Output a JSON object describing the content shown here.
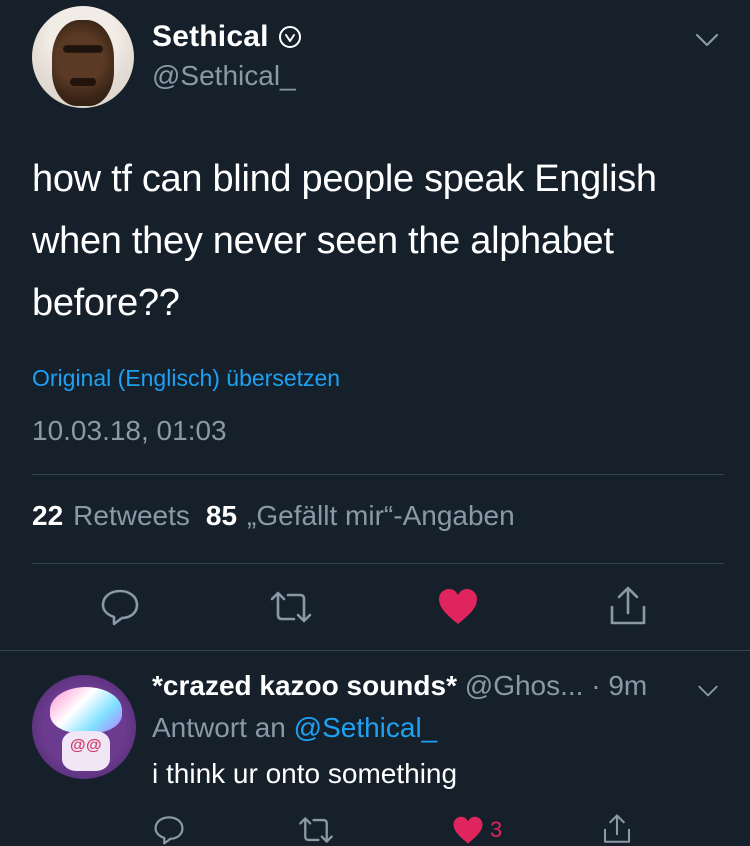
{
  "tweet": {
    "author_name": "Sethical",
    "author_handle": "@Sethical_",
    "text_line1": "how tf can blind people speak English",
    "text_line2": "when they never seen the alphabet",
    "text_line3": "before??",
    "translate_link": "Original (Englisch) übersetzen",
    "timestamp": "10.03.18, 01:03",
    "retweet_count": "22",
    "retweet_label": "Retweets",
    "like_count": "85",
    "like_label": "„Gefällt mir“-Angaben"
  },
  "reply": {
    "author_name": "*crazed kazoo sounds*",
    "author_handle": "@Ghos...",
    "time": "· 9m",
    "reply_prefix": "Antwort an",
    "reply_mention": "@Sethical_",
    "text": "i think ur onto something",
    "like_count": "3"
  },
  "colors": {
    "background": "#15202b",
    "link_blue": "#1da1f2",
    "muted_gray": "#8b98a5",
    "like_red": "#e0245e",
    "divider": "#38444d"
  },
  "icons": {
    "verified": "verified-badge-icon",
    "more": "chevron-down-icon",
    "reply": "reply-icon",
    "retweet": "retweet-icon",
    "like": "heart-icon",
    "share": "share-icon"
  }
}
